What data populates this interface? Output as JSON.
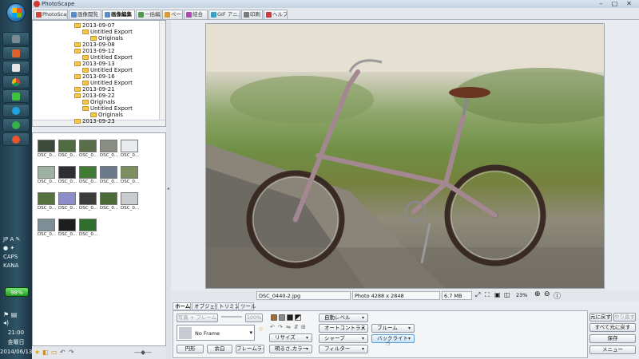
{
  "app": {
    "title": "PhotoScape"
  },
  "window_controls": {
    "minimize": "–",
    "maximize": "□",
    "close": "✕"
  },
  "tabs": [
    {
      "label": "PhotoScape",
      "color": "#d0463a"
    },
    {
      "label": "画像閲覧",
      "color": "#5a8ccc"
    },
    {
      "label": "画像編集",
      "color": "#5a8ccc"
    },
    {
      "label": "一括編集",
      "color": "#4f9a4a"
    },
    {
      "label": "ページ",
      "color": "#d59a3a"
    },
    {
      "label": "結合",
      "color": "#b04ab0"
    },
    {
      "label": "GIF アニメ",
      "color": "#3aa0c0"
    },
    {
      "label": "印刷",
      "color": "#7a7a7a"
    },
    {
      "label": "ヘルプ",
      "color": "#d13a3a"
    }
  ],
  "tree": [
    {
      "label": "2013-09-07",
      "level": 1
    },
    {
      "label": "Untitled Export",
      "level": 2
    },
    {
      "label": "Originals",
      "level": 3
    },
    {
      "label": "2013-09-08",
      "level": 1
    },
    {
      "label": "2013-09-12",
      "level": 1
    },
    {
      "label": "Untitled Export",
      "level": 2
    },
    {
      "label": "2013-09-13",
      "level": 1
    },
    {
      "label": "Untitled Export",
      "level": 2
    },
    {
      "label": "2013-09-16",
      "level": 1
    },
    {
      "label": "Untitled Export",
      "level": 2
    },
    {
      "label": "2013-09-21",
      "level": 1
    },
    {
      "label": "2013-09-22",
      "level": 1
    },
    {
      "label": "Originals",
      "level": 2
    },
    {
      "label": "Untitled Export",
      "level": 2
    },
    {
      "label": "Originals",
      "level": 3
    },
    {
      "label": "2013-09-23",
      "level": 1
    }
  ],
  "thumbnails": [
    {
      "caption": "DSC_0...",
      "color": "#3b4a3a"
    },
    {
      "caption": "DSC_0...",
      "color": "#4f6b3f"
    },
    {
      "caption": "DSC_0...",
      "color": "#5a6f49"
    },
    {
      "caption": "DSC_0...",
      "color": "#8a8d83"
    },
    {
      "caption": "DSC_0...",
      "color": "#e9ecef"
    },
    {
      "caption": "DSC_0...",
      "color": "#9fb1a3"
    },
    {
      "caption": "DSC_0...",
      "color": "#2d2f33"
    },
    {
      "caption": "DSC_0...",
      "color": "#3f7b35"
    },
    {
      "caption": "DSC_0...",
      "color": "#6c7a8a"
    },
    {
      "caption": "DSC_0...",
      "color": "#7d8f5e"
    },
    {
      "caption": "DSC_0...",
      "color": "#56733f"
    },
    {
      "caption": "DSC_0...",
      "color": "#8d8ec9"
    },
    {
      "caption": "DSC_0...",
      "color": "#3a3c3a"
    },
    {
      "caption": "DSC_0...",
      "color": "#4a6b35"
    },
    {
      "caption": "DSC_0...",
      "color": "#c9cccf"
    },
    {
      "caption": "DSC_0...",
      "color": "#7d8e96"
    },
    {
      "caption": "DSC_0...",
      "color": "#1c1f1d"
    },
    {
      "caption": "DSC_0...",
      "color": "#2f6e2c"
    }
  ],
  "status": {
    "filename": "DSC_0440-2.jpg",
    "photo_size": "Photo 4288 x 2848",
    "file_size": "6.7 MB",
    "zoom": "23%"
  },
  "editor": {
    "tabs": [
      "ホーム",
      "オブジェクト",
      "トリミング",
      "ツール"
    ],
    "photo_frame_button": "写真 + フレーム",
    "percent": "100%",
    "frame_value": "No Frame",
    "round_button": "円形",
    "margin_button": "余白",
    "frame_line_button": "フレームライン",
    "auto_level": "自動レベル",
    "auto_contrast": "オートコントラスト",
    "resize": "リサイズ",
    "sharpen": "シャープ",
    "brightness_color": "明るさ,カラー",
    "filter": "フィルター",
    "bloom": "ブルーム",
    "backlight": "バックライト"
  },
  "actions": {
    "undo": "元に戻す",
    "redo": "やり直す",
    "undo_all": "すべて元に戻す",
    "save": "保存",
    "menu": "メニュー"
  },
  "tray": {
    "battery": "98%",
    "time": "21:00",
    "weekday": "金曜日",
    "date": "2014/06/13"
  }
}
